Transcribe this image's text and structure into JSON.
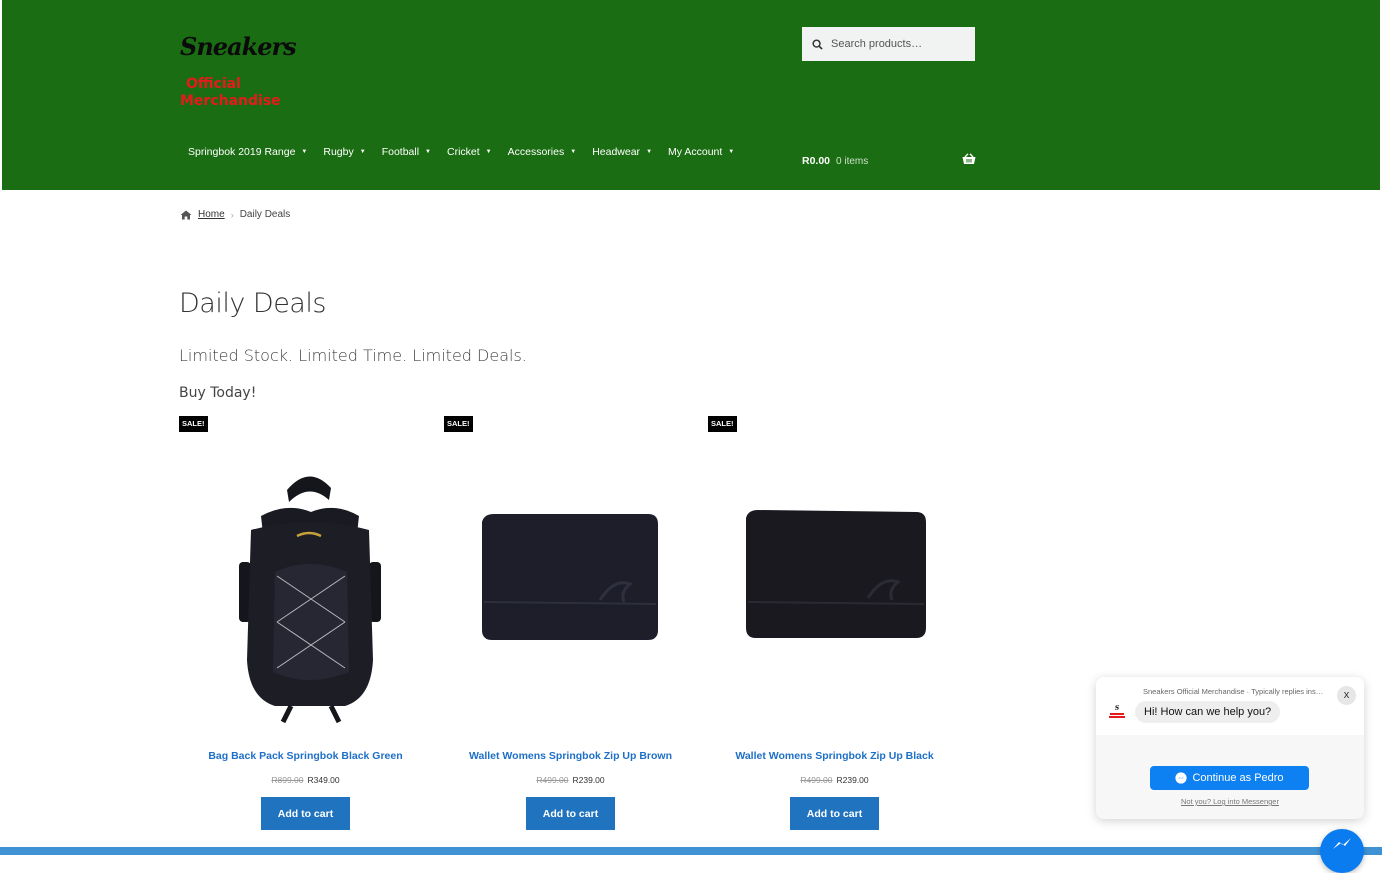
{
  "header": {
    "logo": {
      "script_text": "Sneakers",
      "line1": "Official",
      "line2": "Merchandise"
    },
    "search": {
      "placeholder": "Search products…"
    },
    "nav": [
      {
        "label": "Springbok 2019 Range"
      },
      {
        "label": "Rugby"
      },
      {
        "label": "Football"
      },
      {
        "label": "Cricket"
      },
      {
        "label": "Accessories"
      },
      {
        "label": "Headwear"
      },
      {
        "label": "My Account"
      }
    ],
    "cart": {
      "amount": "R0.00",
      "items": "0 items"
    }
  },
  "breadcrumb": {
    "home": "Home",
    "current": "Daily Deals"
  },
  "page": {
    "title": "Daily Deals",
    "tagline": "Limited Stock. Limited Time. Limited Deals.",
    "buy": "Buy Today!"
  },
  "products": [
    {
      "badge": "SALE!",
      "name": "Bag Back Pack Springbok Black Green",
      "old_price": "R899.00",
      "price": "R349.00",
      "button": "Add to cart"
    },
    {
      "badge": "SALE!",
      "name": "Wallet Womens Springbok Zip Up Brown",
      "old_price": "R499.00",
      "price": "R239.00",
      "button": "Add to cart"
    },
    {
      "badge": "SALE!",
      "name": "Wallet Womens Springbok Zip Up Black",
      "old_price": "R499.00",
      "price": "R239.00",
      "button": "Add to cart"
    }
  ],
  "chat": {
    "name": "Sneakers Official Merchandise · Typically replies instantly",
    "message": "Hi! How can we help you?",
    "close": "x",
    "continue": "Continue as Pedro",
    "not_you": "Not you? Log into Messenger"
  },
  "colors": {
    "header_bg": "#1a6d12",
    "link_blue": "#1e6fc7",
    "button_blue": "#2073bf",
    "sale_bg": "#000000",
    "logo_red": "#e51b1b",
    "messenger_blue": "#0d80f2"
  }
}
